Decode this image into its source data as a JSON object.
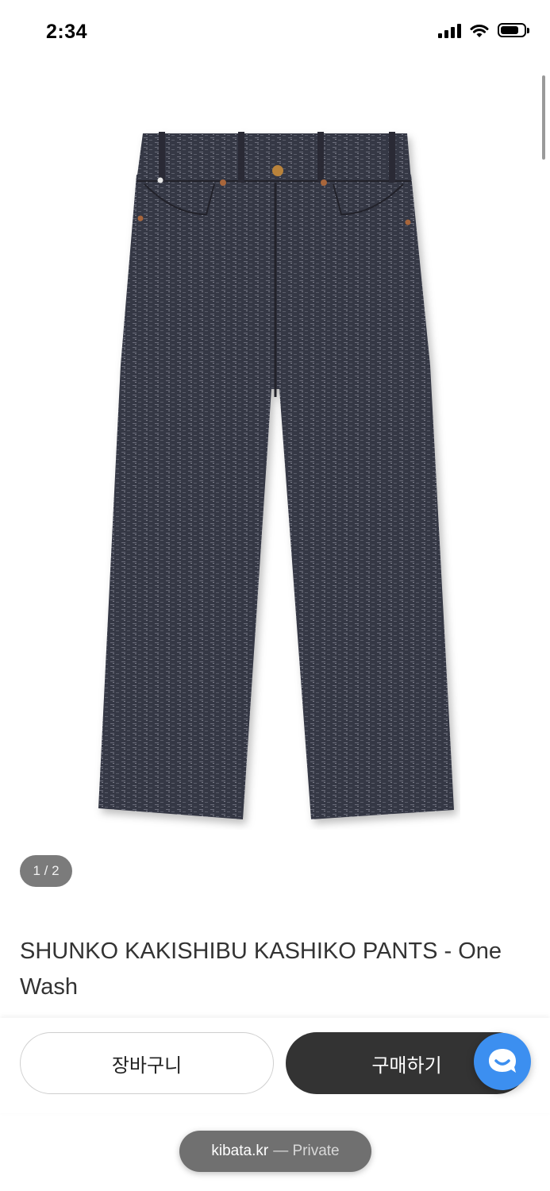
{
  "status_bar": {
    "time": "2:34"
  },
  "gallery": {
    "counter": "1 / 2"
  },
  "product": {
    "title": "SHUNKO KAKISHIBU KASHIKO PANTS - One Wash"
  },
  "actions": {
    "cart_label": "장바구니",
    "buy_label": "구매하기"
  },
  "browser": {
    "domain": "kibata.kr",
    "mode": "— Private"
  },
  "colors": {
    "buy_button": "#333333",
    "chat_button": "#3c8ff0",
    "counter_badge": "#7b7b7b"
  }
}
